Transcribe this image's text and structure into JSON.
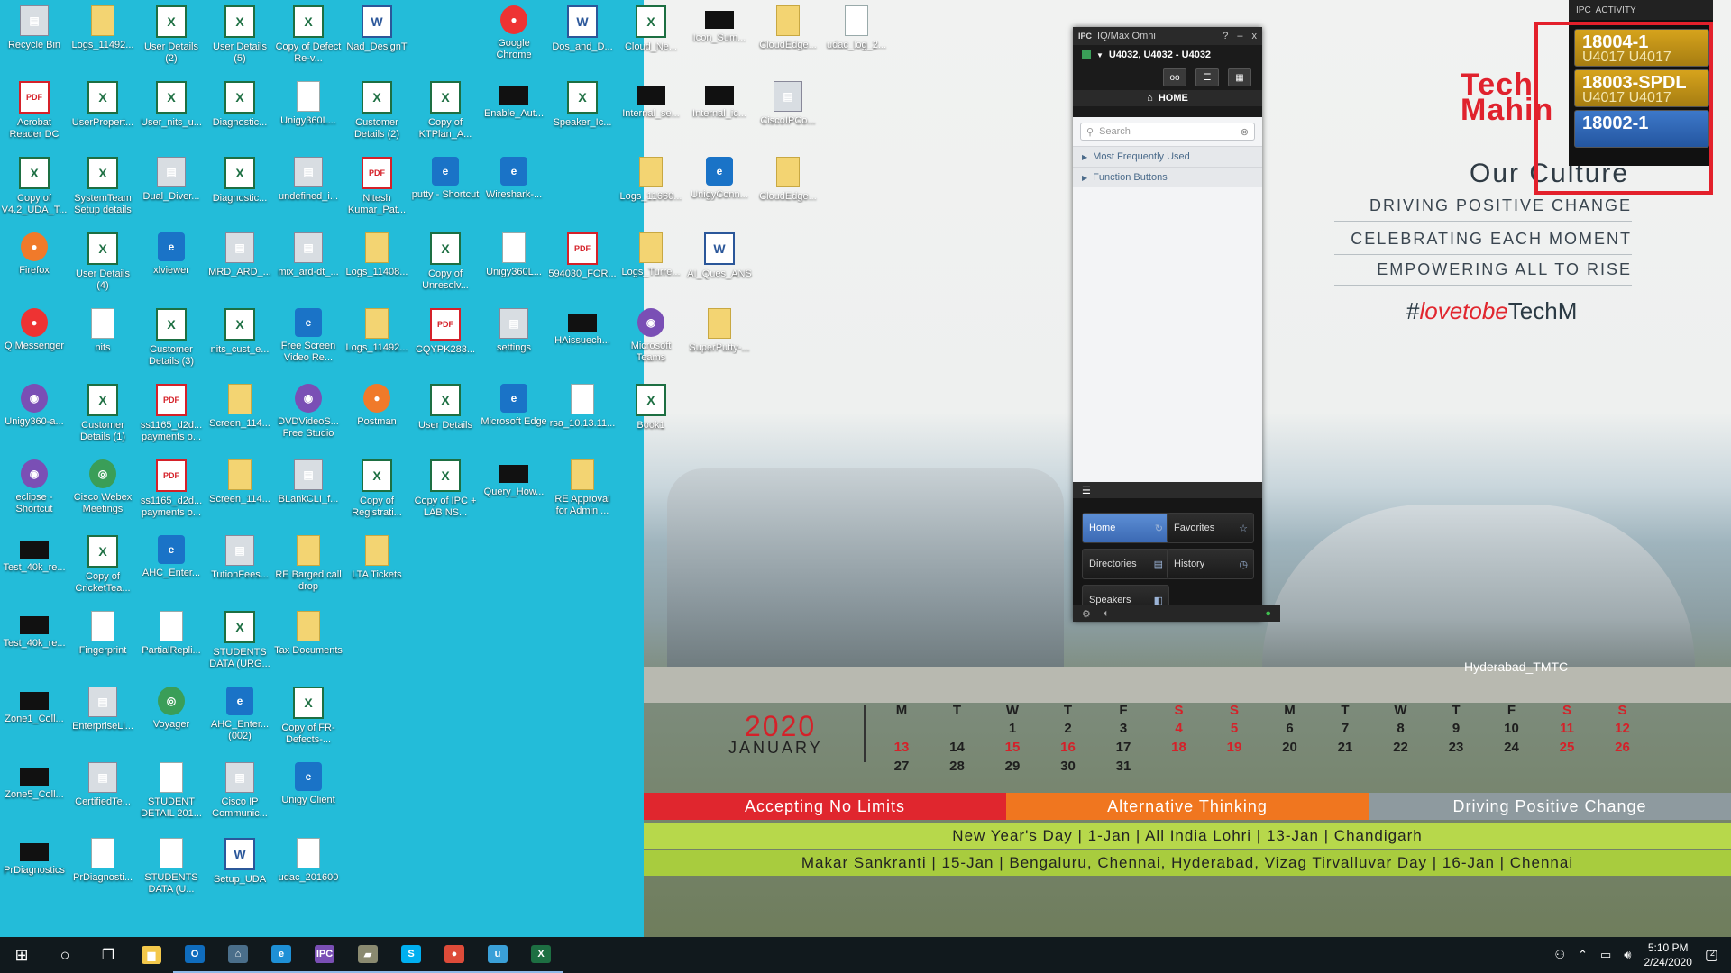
{
  "wallpaper": {
    "logo_line1": "Tech",
    "logo_line2": "Mahin",
    "culture_title": "Our Culture",
    "mottos": [
      "DRIVING POSITIVE CHANGE",
      "CELEBRATING EACH MOMENT",
      "EMPOWERING ALL TO RISE"
    ],
    "hashtag_prefix": "#",
    "hashtag_love": "lovetobe",
    "hashtag_suffix": "TechM",
    "photo_caption": "Hyderabad_TMTC",
    "calendar": {
      "year": "2020",
      "month": "JANUARY",
      "weekdays": [
        "M",
        "T",
        "W",
        "T",
        "F",
        "S",
        "S",
        "M",
        "T",
        "W",
        "T",
        "F",
        "S",
        "S"
      ],
      "rows": [
        [
          "",
          "",
          "1",
          "2",
          "3",
          "4",
          "5",
          "6",
          "7",
          "8",
          "9",
          "10",
          "11",
          "12"
        ],
        [
          "13",
          "14",
          "15",
          "16",
          "17",
          "18",
          "19",
          "20",
          "21",
          "22",
          "23",
          "24",
          "25",
          "26"
        ],
        [
          "27",
          "28",
          "29",
          "30",
          "31",
          "",
          "",
          "",
          "",
          "",
          "",
          "",
          "",
          ""
        ]
      ],
      "red_days": [
        "4",
        "5",
        "11",
        "12",
        "13",
        "15",
        "16",
        "18",
        "19",
        "25",
        "26"
      ]
    },
    "banner1": [
      {
        "text": "Accepting No Limits",
        "color": "#e0262e"
      },
      {
        "text": "Alternative Thinking",
        "color": "#f0761f"
      },
      {
        "text": "Driving Positive Change",
        "color": "#8e9a9f"
      }
    ],
    "banner2": "New Year's Day  |  1-Jan  |  All India     Lohri  |  13-Jan  |  Chandigarh",
    "banner3": "Makar Sankranti  |  15-Jan  |  Bengaluru, Chennai, Hyderabad, Vizag     Tirvalluvar Day  |  16-Jan  |  Chennai"
  },
  "desktop_icons": [
    {
      "label": "Recycle Bin",
      "type": "gray",
      "col": 0,
      "row": 0
    },
    {
      "label": "Logs_11492...",
      "type": "folder",
      "col": 1,
      "row": 0
    },
    {
      "label": "User Details (2)",
      "type": "excel",
      "col": 2,
      "row": 0
    },
    {
      "label": "User Details (5)",
      "type": "excel",
      "col": 3,
      "row": 0
    },
    {
      "label": "Copy of Defect Re-v...",
      "type": "excel",
      "col": 4,
      "row": 0
    },
    {
      "label": "Nad_DesignT",
      "type": "word",
      "col": 5,
      "row": 0
    },
    {
      "label": "Google Chrome",
      "type": "round",
      "col": 7,
      "row": 0
    },
    {
      "label": "Dos_and_D...",
      "type": "word",
      "col": 8,
      "row": 0
    },
    {
      "label": "Cloud_Ne...",
      "type": "excel",
      "col": 9,
      "row": 0
    },
    {
      "label": "Icon_Sum...",
      "type": "black",
      "col": 10,
      "row": 0
    },
    {
      "label": "CloudEdge...",
      "type": "folder",
      "col": 11,
      "row": 0
    },
    {
      "label": "udac_log_2...",
      "type": "doc",
      "col": 12,
      "row": 0
    },
    {
      "label": "Acrobat Reader DC",
      "type": "pdf",
      "col": 0,
      "row": 1
    },
    {
      "label": "UserPropert...",
      "type": "excel",
      "col": 1,
      "row": 1
    },
    {
      "label": "User_nits_u...",
      "type": "excel",
      "col": 2,
      "row": 1
    },
    {
      "label": "Diagnostic...",
      "type": "excel",
      "col": 3,
      "row": 1
    },
    {
      "label": "Unigy360L...",
      "type": "doc",
      "col": 4,
      "row": 1
    },
    {
      "label": "Customer Details (2)",
      "type": "excel",
      "col": 5,
      "row": 1
    },
    {
      "label": "Copy of KTPlan_A...",
      "type": "excel",
      "col": 6,
      "row": 1
    },
    {
      "label": "Enable_Aut...",
      "type": "black",
      "col": 7,
      "row": 1
    },
    {
      "label": "Speaker_Ic...",
      "type": "excel",
      "col": 8,
      "row": 1
    },
    {
      "label": "Internal_se...",
      "type": "black",
      "col": 9,
      "row": 1
    },
    {
      "label": "Internal_ic...",
      "type": "black",
      "col": 10,
      "row": 1
    },
    {
      "label": "CiscoIPCo...",
      "type": "gray",
      "col": 11,
      "row": 1
    },
    {
      "label": "Copy of V4.2_UDA_T...",
      "type": "excel",
      "col": 0,
      "row": 2
    },
    {
      "label": "SystemTeam Setup details",
      "type": "excel",
      "col": 1,
      "row": 2
    },
    {
      "label": "Dual_Diver...",
      "type": "gray",
      "col": 2,
      "row": 2
    },
    {
      "label": "Diagnostic...",
      "type": "excel",
      "col": 3,
      "row": 2
    },
    {
      "label": "undefined_i...",
      "type": "gray",
      "col": 4,
      "row": 2
    },
    {
      "label": "Nitesh Kumar_Pat...",
      "type": "pdf",
      "col": 5,
      "row": 2
    },
    {
      "label": "putty - Shortcut",
      "type": "blue",
      "col": 6,
      "row": 2
    },
    {
      "label": "Wireshark-...",
      "type": "blue",
      "col": 7,
      "row": 2
    },
    {
      "label": "Logs_11660...",
      "type": "folder",
      "col": 9,
      "row": 2
    },
    {
      "label": "UnigyConn...",
      "type": "blue",
      "col": 10,
      "row": 2
    },
    {
      "label": "CloudEdge...",
      "type": "folder",
      "col": 11,
      "row": 2
    },
    {
      "label": "Firefox",
      "type": "orange",
      "col": 0,
      "row": 3
    },
    {
      "label": "User Details (4)",
      "type": "excel",
      "col": 1,
      "row": 3
    },
    {
      "label": "xlviewer",
      "type": "blue",
      "col": 2,
      "row": 3
    },
    {
      "label": "MRD_ARD_...",
      "type": "gray",
      "col": 3,
      "row": 3
    },
    {
      "label": "mix_ard-dt_...",
      "type": "gray",
      "col": 4,
      "row": 3
    },
    {
      "label": "Logs_11408...",
      "type": "folder",
      "col": 5,
      "row": 3
    },
    {
      "label": "Copy of Unresolv...",
      "type": "excel",
      "col": 6,
      "row": 3
    },
    {
      "label": "Unigy360L...",
      "type": "doc",
      "col": 7,
      "row": 3
    },
    {
      "label": "594030_FOR...",
      "type": "pdf",
      "col": 8,
      "row": 3
    },
    {
      "label": "Logs_Turre...",
      "type": "folder",
      "col": 9,
      "row": 3
    },
    {
      "label": "AI_Ques_ANS",
      "type": "word",
      "col": 10,
      "row": 3
    },
    {
      "label": "Q Messenger",
      "type": "round",
      "col": 0,
      "row": 4
    },
    {
      "label": "nits",
      "type": "doc",
      "col": 1,
      "row": 4
    },
    {
      "label": "Customer Details (3)",
      "type": "excel",
      "col": 2,
      "row": 4
    },
    {
      "label": "nits_cust_e...",
      "type": "excel",
      "col": 3,
      "row": 4
    },
    {
      "label": "Free Screen Video Re...",
      "type": "blue",
      "col": 4,
      "row": 4
    },
    {
      "label": "Logs_11492...",
      "type": "folder",
      "col": 5,
      "row": 4
    },
    {
      "label": "CQYPK283...",
      "type": "pdf",
      "col": 6,
      "row": 4
    },
    {
      "label": "settings",
      "type": "gray",
      "col": 7,
      "row": 4
    },
    {
      "label": "HAissuech...",
      "type": "black",
      "col": 8,
      "row": 4
    },
    {
      "label": "Microsoft Teams",
      "type": "purple",
      "col": 9,
      "row": 4
    },
    {
      "label": "SuperPutty-...",
      "type": "folder",
      "col": 10,
      "row": 4
    },
    {
      "label": "Unigy360-a...",
      "type": "purple",
      "col": 0,
      "row": 5
    },
    {
      "label": "Customer Details (1)",
      "type": "excel",
      "col": 1,
      "row": 5
    },
    {
      "label": "ss1165_d2d... payments o...",
      "type": "pdf",
      "col": 2,
      "row": 5
    },
    {
      "label": "Screen_114...",
      "type": "folder",
      "col": 3,
      "row": 5
    },
    {
      "label": "DVDVideoS... Free Studio",
      "type": "purple",
      "col": 4,
      "row": 5
    },
    {
      "label": "Postman",
      "type": "orange",
      "col": 5,
      "row": 5
    },
    {
      "label": "User Details",
      "type": "excel",
      "col": 6,
      "row": 5
    },
    {
      "label": "Microsoft Edge",
      "type": "blue",
      "col": 7,
      "row": 5
    },
    {
      "label": "rsa_10.13.11...",
      "type": "doc",
      "col": 8,
      "row": 5
    },
    {
      "label": "Book1",
      "type": "excel",
      "col": 9,
      "row": 5
    },
    {
      "label": "eclipse - Shortcut",
      "type": "purple",
      "col": 0,
      "row": 6
    },
    {
      "label": "Cisco Webex Meetings",
      "type": "green",
      "col": 1,
      "row": 6
    },
    {
      "label": "ss1165_d2d... payments o...",
      "type": "pdf",
      "col": 2,
      "row": 6
    },
    {
      "label": "Screen_114...",
      "type": "folder",
      "col": 3,
      "row": 6
    },
    {
      "label": "BLankCLI_f...",
      "type": "gray",
      "col": 4,
      "row": 6
    },
    {
      "label": "Copy of Registrati...",
      "type": "excel",
      "col": 5,
      "row": 6
    },
    {
      "label": "Copy of IPC + LAB NS...",
      "type": "excel",
      "col": 6,
      "row": 6
    },
    {
      "label": "Query_How...",
      "type": "black",
      "col": 7,
      "row": 6
    },
    {
      "label": "RE Approval for Admin ...",
      "type": "folder",
      "col": 8,
      "row": 6
    },
    {
      "label": "Test_40k_re...",
      "type": "black",
      "col": 0,
      "row": 7
    },
    {
      "label": "Copy of CricketTea...",
      "type": "excel",
      "col": 1,
      "row": 7
    },
    {
      "label": "AHC_Enter...",
      "type": "blue",
      "col": 2,
      "row": 7
    },
    {
      "label": "TutionFees...",
      "type": "gray",
      "col": 3,
      "row": 7
    },
    {
      "label": "RE Barged call drop",
      "type": "folder",
      "col": 4,
      "row": 7
    },
    {
      "label": "LTA Tickets",
      "type": "folder",
      "col": 5,
      "row": 7
    },
    {
      "label": "Test_40k_re...",
      "type": "black",
      "col": 0,
      "row": 8
    },
    {
      "label": "Fingerprint",
      "type": "doc",
      "col": 1,
      "row": 8
    },
    {
      "label": "PartialRepli...",
      "type": "doc",
      "col": 2,
      "row": 8
    },
    {
      "label": "STUDENTS DATA (URG...",
      "type": "excel",
      "col": 3,
      "row": 8
    },
    {
      "label": "Tax Documents",
      "type": "folder",
      "col": 4,
      "row": 8
    },
    {
      "label": "Zone1_Coll...",
      "type": "black",
      "col": 0,
      "row": 9
    },
    {
      "label": "EnterpriseLi...",
      "type": "gray",
      "col": 1,
      "row": 9
    },
    {
      "label": "Voyager",
      "type": "green",
      "col": 2,
      "row": 9
    },
    {
      "label": "AHC_Enter... (002)",
      "type": "blue",
      "col": 3,
      "row": 9
    },
    {
      "label": "Copy of FR-Defects-...",
      "type": "excel",
      "col": 4,
      "row": 9
    },
    {
      "label": "Zone5_Coll...",
      "type": "black",
      "col": 0,
      "row": 10
    },
    {
      "label": "CertifiedTe...",
      "type": "gray",
      "col": 1,
      "row": 10
    },
    {
      "label": "STUDENT DETAIL 201...",
      "type": "doc",
      "col": 2,
      "row": 10
    },
    {
      "label": "Cisco IP Communic...",
      "type": "gray",
      "col": 3,
      "row": 10
    },
    {
      "label": "Unigy Client",
      "type": "blue",
      "col": 4,
      "row": 10
    },
    {
      "label": "PrDiagnostics",
      "type": "black",
      "col": 0,
      "row": 11
    },
    {
      "label": "PrDiagnosti...",
      "type": "doc",
      "col": 1,
      "row": 11
    },
    {
      "label": "STUDENTS DATA (U...",
      "type": "doc",
      "col": 2,
      "row": 11
    },
    {
      "label": "Setup_UDA",
      "type": "word",
      "col": 3,
      "row": 11
    },
    {
      "label": "udac_201600",
      "type": "doc",
      "col": 4,
      "row": 11
    }
  ],
  "iq_window": {
    "title": "IQ/Max Omni",
    "title_controls": [
      "?",
      "–",
      "x"
    ],
    "lines": "U4032, U4032 - U4032",
    "home_label": "HOME",
    "search_placeholder": "Search",
    "sections": [
      "Most Frequently Used",
      "Function Buttons"
    ],
    "nav": [
      {
        "label": "Home",
        "active": true
      },
      {
        "label": "Favorites",
        "active": false
      },
      {
        "label": "Directories",
        "active": false
      },
      {
        "label": "History",
        "active": false
      },
      {
        "label": "Speakers",
        "active": false
      }
    ]
  },
  "activity": {
    "title": "ACTIVITY",
    "buttons": [
      {
        "main": "18004-1",
        "sub": "U4017 U4017",
        "color": "y"
      },
      {
        "main": "18003-SPDL",
        "sub": "U4017 U4017",
        "color": "y"
      },
      {
        "main": "18002-1",
        "sub": "",
        "color": "b"
      }
    ]
  },
  "taskbar": {
    "apps": [
      {
        "name": "file-explorer",
        "color": "#f3c84b",
        "glyph": "▆"
      },
      {
        "name": "outlook",
        "color": "#0f6cbd",
        "glyph": "O"
      },
      {
        "name": "network-app",
        "color": "#4a6e8a",
        "glyph": "⌂"
      },
      {
        "name": "internet-explorer",
        "color": "#1e90d6",
        "glyph": "e"
      },
      {
        "name": "ipc",
        "color": "#7a4fb5",
        "glyph": "IPC"
      },
      {
        "name": "tool",
        "color": "#8a8a70",
        "glyph": "▰"
      },
      {
        "name": "skype",
        "color": "#00aff0",
        "glyph": "S"
      },
      {
        "name": "chrome",
        "color": "#dd4b39",
        "glyph": "●"
      },
      {
        "name": "unigy",
        "color": "#3aa0d8",
        "glyph": "u"
      },
      {
        "name": "excel",
        "color": "#1d6f42",
        "glyph": "X"
      }
    ],
    "time": "5:10 PM",
    "date": "2/24/2020",
    "notification_count": "2"
  }
}
